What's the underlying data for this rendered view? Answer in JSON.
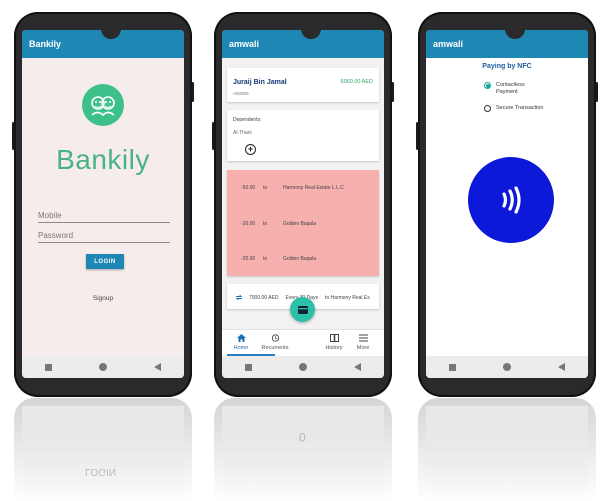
{
  "login_screen": {
    "app_title": "Bankily",
    "brand_name": "Bankily",
    "mobile_placeholder": "Mobile",
    "password_placeholder": "Password",
    "login_label": "LOGIN",
    "signup_label": "Signup"
  },
  "home_screen": {
    "app_title": "amwali",
    "account": {
      "name": "Juraij Bin Jamal",
      "balance": "6960.00 AED",
      "number": "A00000"
    },
    "dependents": {
      "title": "Dependents:",
      "items": [
        "Al-Thani"
      ]
    },
    "transactions": [
      {
        "amount": "-50.00",
        "to": "to",
        "payee": "Harmony Real Estate L.L.C"
      },
      {
        "amount": "-20.00",
        "to": "to",
        "payee": "Golden Baqala"
      },
      {
        "amount": "-20.00",
        "to": "to",
        "payee": "Golden Baqala"
      }
    ],
    "recurrent": {
      "amount": "7000.00 AED",
      "frequency": "Every 30 Days",
      "payee": "to Harmony Real Es"
    },
    "nav": {
      "home": "Home",
      "recurrents": "Recurrents",
      "history": "History",
      "more": "More"
    }
  },
  "nfc_screen": {
    "app_title": "amwali",
    "title": "Paying by NFC",
    "options": [
      "Contactless Payment",
      "Secure Transaction"
    ],
    "selected_option": "Contactless Payment"
  },
  "reflections": {
    "login_text": "LOGIN",
    "keypad_digit": "0"
  },
  "colors": {
    "app_bar": "#1f87b3",
    "brand_green": "#46b484",
    "transaction_bg": "#f6b0ae",
    "nfc_blue": "#0d19d8",
    "fab": "#2cc0a8"
  }
}
